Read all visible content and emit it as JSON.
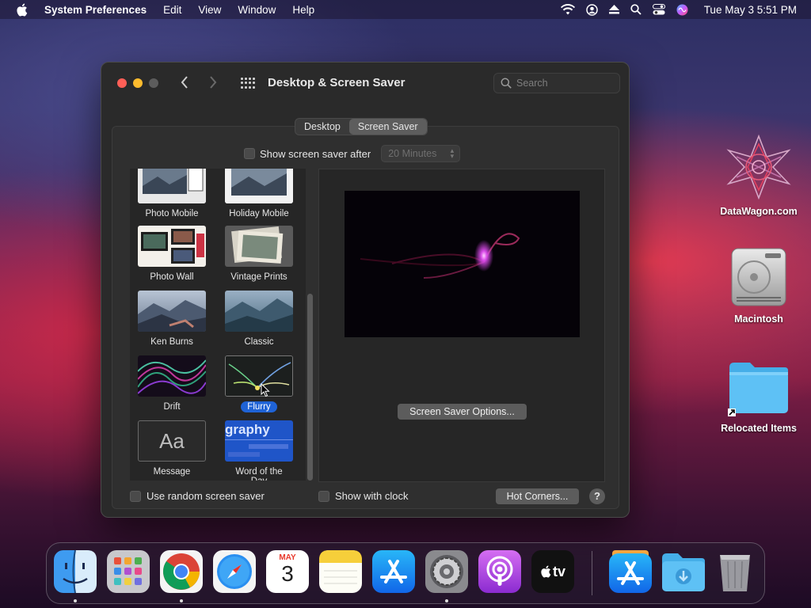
{
  "menubar": {
    "app_name": "System Preferences",
    "menus": [
      "Edit",
      "View",
      "Window",
      "Help"
    ],
    "clock": "Tue May 3  5:51 PM"
  },
  "desktop": {
    "icons": [
      {
        "label": "DataWagon.com"
      },
      {
        "label": "Macintosh"
      },
      {
        "label": "Relocated Items"
      }
    ]
  },
  "window": {
    "title": "Desktop & Screen Saver",
    "search_placeholder": "Search",
    "tabs": [
      {
        "label": "Desktop",
        "active": false
      },
      {
        "label": "Screen Saver",
        "active": true
      }
    ],
    "show_after_label": "Show screen saver after",
    "show_after_value": "20 Minutes",
    "savers": [
      {
        "label": "Photo Mobile",
        "selected": false
      },
      {
        "label": "Holiday Mobile",
        "selected": false
      },
      {
        "label": "Photo Wall",
        "selected": false
      },
      {
        "label": "Vintage Prints",
        "selected": false
      },
      {
        "label": "Ken Burns",
        "selected": false
      },
      {
        "label": "Classic",
        "selected": false
      },
      {
        "label": "Drift",
        "selected": false
      },
      {
        "label": "Flurry",
        "selected": true
      },
      {
        "label": "Message",
        "selected": false
      },
      {
        "label": "Word of the Day",
        "selected": false
      }
    ],
    "message_thumb_text": "Aa",
    "word_thumb_text": "graphy",
    "options_button": "Screen Saver Options...",
    "random_label": "Use random screen saver",
    "clock_label": "Show with clock",
    "hot_corners_button": "Hot Corners...",
    "help_label": "?"
  },
  "dock": {
    "calendar_month": "MAY",
    "calendar_day": "3",
    "tv_label": "tv",
    "items": [
      "Finder",
      "Launchpad",
      "Chrome",
      "Safari",
      "Calendar",
      "Notes",
      "App Store",
      "System Preferences",
      "Podcasts",
      "Apple TV",
      "App Store Downloads",
      "Downloads",
      "Trash"
    ]
  },
  "colors": {
    "accent": "#1f63d6",
    "close": "#ff5f57",
    "minimize": "#febc2e"
  }
}
